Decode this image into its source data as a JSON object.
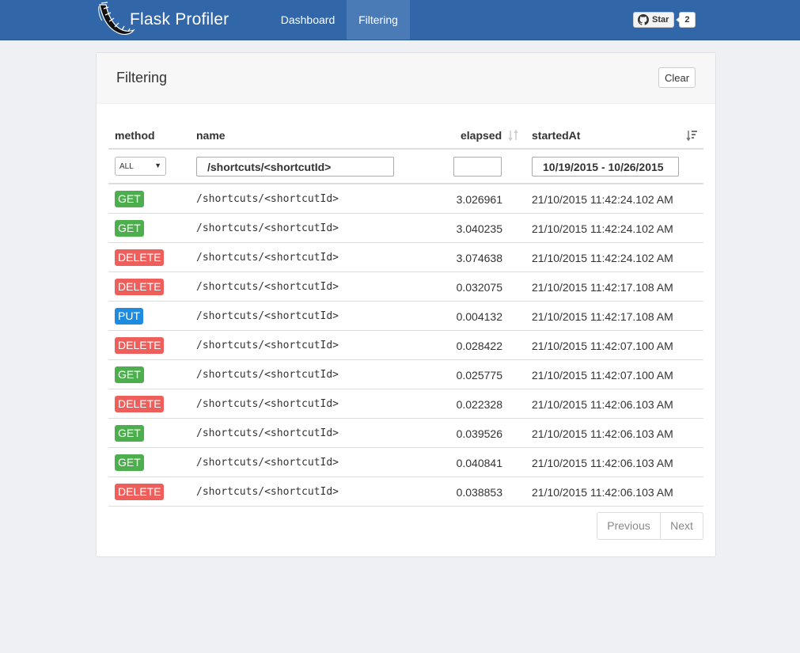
{
  "navbar": {
    "brand": "Flask Profiler",
    "links": [
      {
        "label": "Dashboard"
      },
      {
        "label": "Filtering"
      }
    ],
    "github": {
      "star_label": "Star",
      "count": "2"
    }
  },
  "panel": {
    "title": "Filtering",
    "clear_label": "Clear"
  },
  "table": {
    "columns": [
      "method",
      "name",
      "elapsed",
      "startedAt"
    ],
    "filters": {
      "method": "ALL",
      "name": "/shortcuts/<shortcutId>",
      "elapsed": "",
      "date_range": "10/19/2015 - 10/26/2015"
    },
    "rows": [
      {
        "method": "GET",
        "name": "/shortcuts/<shortcutId>",
        "elapsed": "3.026961",
        "startedAt": "21/10/2015 11:42:24.102 AM"
      },
      {
        "method": "GET",
        "name": "/shortcuts/<shortcutId>",
        "elapsed": "3.040235",
        "startedAt": "21/10/2015 11:42:24.102 AM"
      },
      {
        "method": "DELETE",
        "name": "/shortcuts/<shortcutId>",
        "elapsed": "3.074638",
        "startedAt": "21/10/2015 11:42:24.102 AM"
      },
      {
        "method": "DELETE",
        "name": "/shortcuts/<shortcutId>",
        "elapsed": "0.032075",
        "startedAt": "21/10/2015 11:42:17.108 AM"
      },
      {
        "method": "PUT",
        "name": "/shortcuts/<shortcutId>",
        "elapsed": "0.004132",
        "startedAt": "21/10/2015 11:42:17.108 AM"
      },
      {
        "method": "DELETE",
        "name": "/shortcuts/<shortcutId>",
        "elapsed": "0.028422",
        "startedAt": "21/10/2015 11:42:07.100 AM"
      },
      {
        "method": "GET",
        "name": "/shortcuts/<shortcutId>",
        "elapsed": "0.025775",
        "startedAt": "21/10/2015 11:42:07.100 AM"
      },
      {
        "method": "DELETE",
        "name": "/shortcuts/<shortcutId>",
        "elapsed": "0.022328",
        "startedAt": "21/10/2015 11:42:06.103 AM"
      },
      {
        "method": "GET",
        "name": "/shortcuts/<shortcutId>",
        "elapsed": "0.039526",
        "startedAt": "21/10/2015 11:42:06.103 AM"
      },
      {
        "method": "GET",
        "name": "/shortcuts/<shortcutId>",
        "elapsed": "0.040841",
        "startedAt": "21/10/2015 11:42:06.103 AM"
      },
      {
        "method": "DELETE",
        "name": "/shortcuts/<shortcutId>",
        "elapsed": "0.038853",
        "startedAt": "21/10/2015 11:42:06.103 AM"
      }
    ]
  },
  "pagination": {
    "prev_label": "Previous",
    "next_label": "Next"
  },
  "colors": {
    "navbar": "#3166a8",
    "GET": "#4cae4c",
    "DELETE": "#ee5f5b",
    "PUT": "#1d8ce0"
  },
  "icons": {
    "logo": "flask-horn-logo",
    "github": "github-icon",
    "sort": "sort-icon"
  }
}
